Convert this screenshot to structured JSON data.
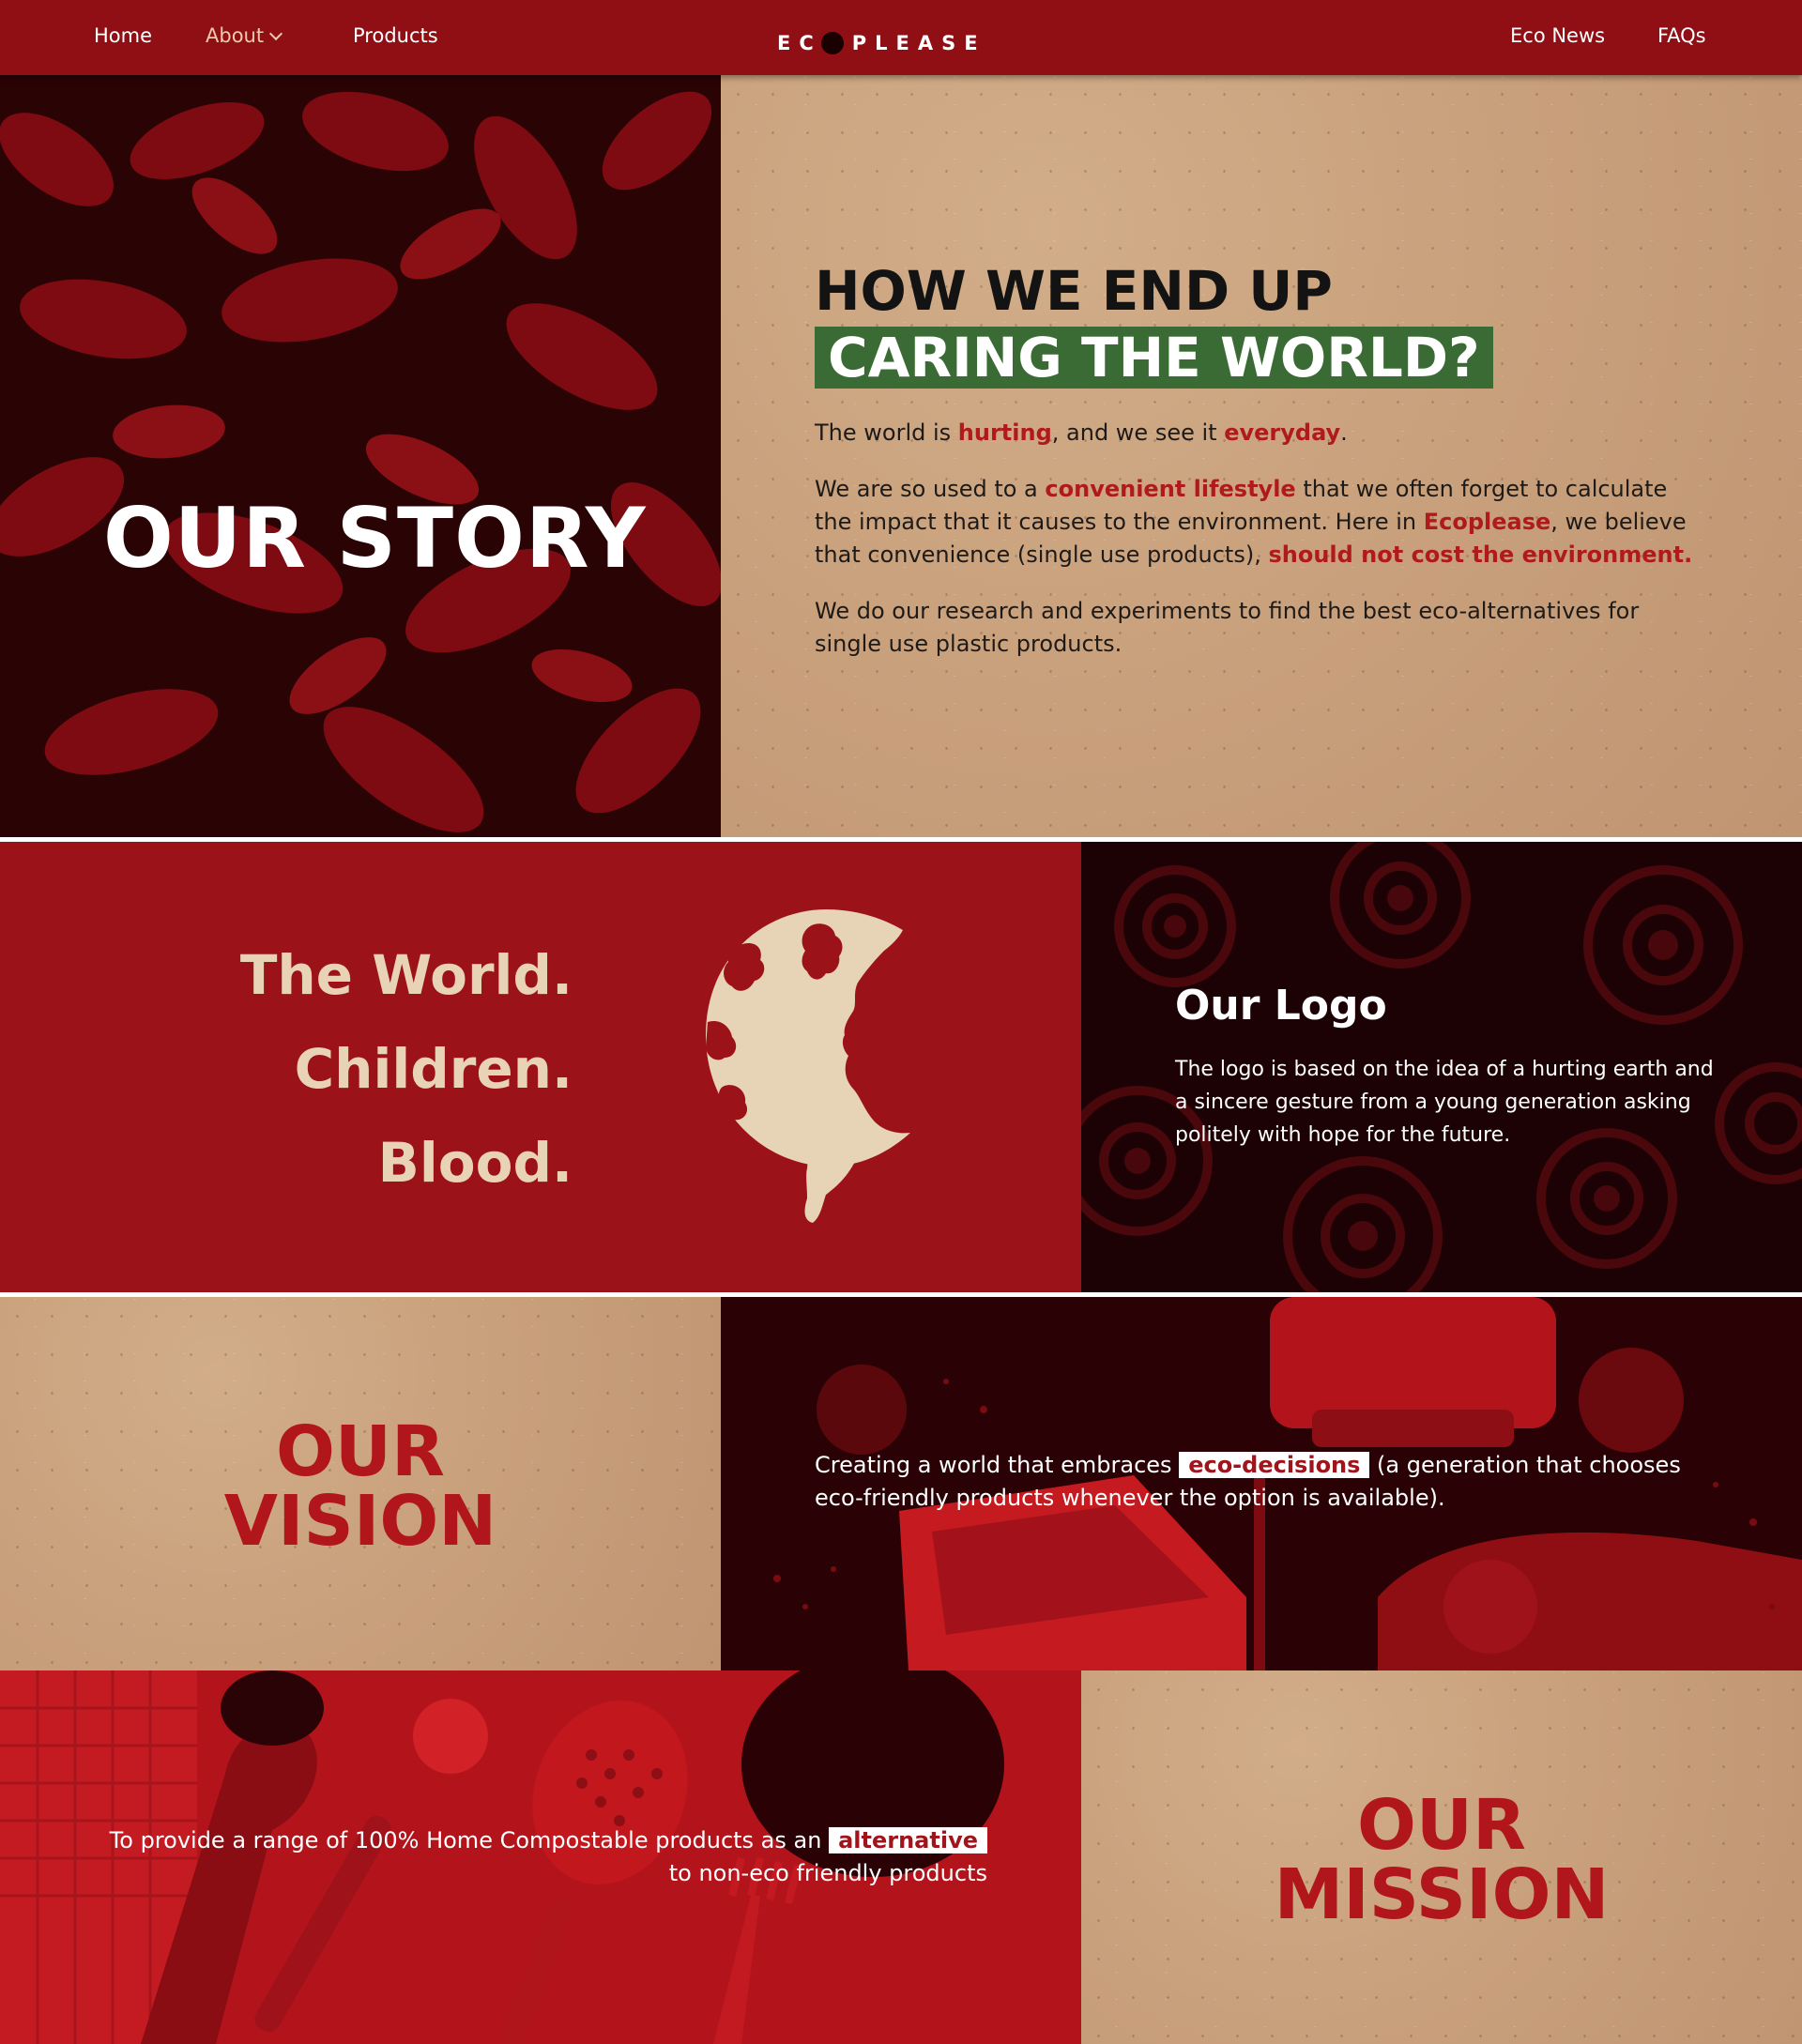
{
  "nav": {
    "home": "Home",
    "about": "About",
    "products": "Products",
    "logo_left": "EC",
    "logo_right": "PLEASE",
    "eco_news": "Eco News",
    "faqs": "FAQs"
  },
  "story": {
    "title": "OUR STORY",
    "heading_line1": "HOW WE END UP",
    "heading_line2": "CARING THE WORLD?",
    "p1": [
      "The world is ",
      "hurting",
      ", and we see it ",
      "everyday",
      "."
    ],
    "p2": [
      "We are so used to a ",
      "convenient lifestyle",
      " that we often forget to calculate the impact that it causes to the environment. Here in ",
      "Ecoplease",
      ", we believe that convenience (single use products), ",
      "should not cost the environment."
    ],
    "p3": "We do our research and experiments to find the best eco-alternatives for single use plastic products."
  },
  "logo_section": {
    "triad": [
      "The World.",
      "Children.",
      "Blood."
    ],
    "title": "Our Logo",
    "description": "The logo is based on the idea of a hurting earth and a sincere gesture from a young generation asking politely with hope for the future."
  },
  "vision": {
    "title_line1": "OUR",
    "title_line2": "VISION",
    "copy_before": "Creating a world that embraces ",
    "copy_chip": "eco-decisions",
    "copy_after": " (a generation that chooses eco-friendly products whenever the option is available)."
  },
  "mission": {
    "title_line1": "OUR",
    "title_line2": "MISSION",
    "copy_before": "To provide a range of 100% Home Compostable products as an ",
    "copy_chip": "alternative",
    "copy_after": "to non-eco friendly products"
  },
  "colors": {
    "brand_red": "#9c1219",
    "accent_green": "#3b6b34",
    "kraft": "#c9a17c",
    "cream": "#e9d3b7"
  }
}
